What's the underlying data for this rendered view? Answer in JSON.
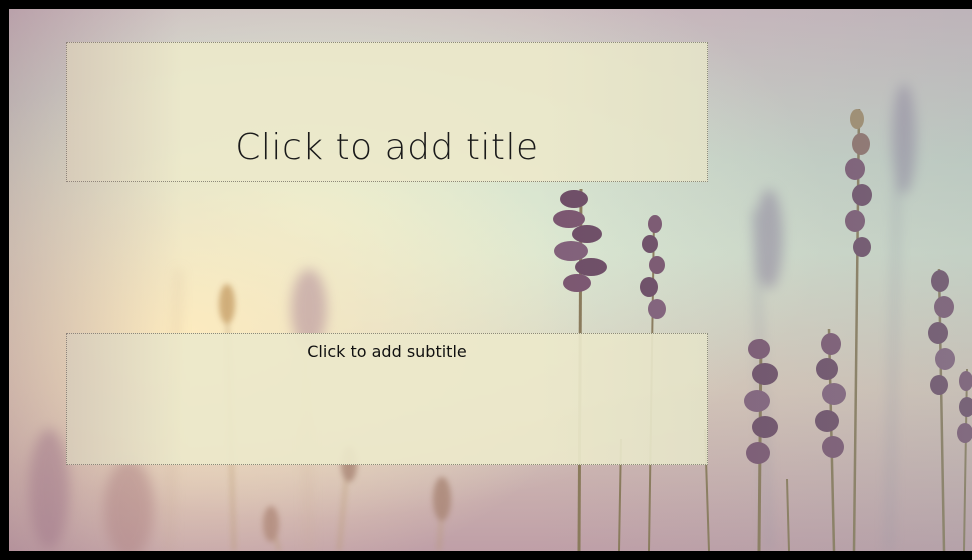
{
  "slide": {
    "title_placeholder": "Click to add title",
    "subtitle_placeholder": "Click to add subtitle"
  },
  "colors": {
    "frame": "#000000",
    "placeholder_fill": "#ece8ca",
    "placeholder_border": "#8d8a7a",
    "flower": "#7a5a74",
    "stem": "#9a8a6a"
  }
}
